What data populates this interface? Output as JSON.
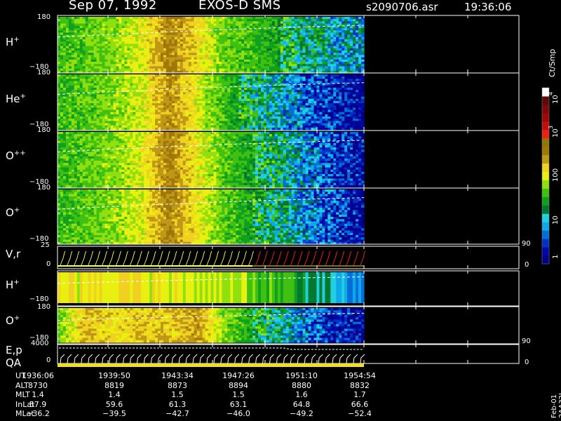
{
  "header": {
    "date": "Sep 07, 1992",
    "instrument": "EXOS-D SMS",
    "file": "s2090706.asr",
    "time": "19:36:06"
  },
  "colorbar": {
    "unit": "Ct/Smp",
    "tick_labels": [
      "1",
      "10",
      "100",
      "10",
      "10"
    ],
    "superscripts": [
      "3",
      "4"
    ],
    "colors": [
      "#000088",
      "#0008a8",
      "#0030c8",
      "#0070d8",
      "#10a8e8",
      "#20d0e0",
      "#007830",
      "#10a020",
      "#40c010",
      "#90e010",
      "#e8f010",
      "#f0d020",
      "#c09818",
      "#a07808",
      "#907808",
      "#f02010",
      "#c01008",
      "#a00808",
      "#800808",
      "#600808",
      "#ffffff"
    ]
  },
  "panels": [
    {
      "label": "H",
      "sup": "+",
      "ytop": "180",
      "ybot": "−180"
    },
    {
      "label": "He",
      "sup": "+",
      "ytop": "180",
      "ybot": "−180"
    },
    {
      "label": "O",
      "sup": "++",
      "ytop": "180",
      "ybot": "−180"
    },
    {
      "label": "O",
      "sup": "+",
      "ytop": "180",
      "ybot": "−180"
    },
    {
      "label": "V,r",
      "sup": "",
      "ytop": "25",
      "ybot": "0",
      "rtop": "90",
      "rbot": "0"
    },
    {
      "label": "H",
      "sup": "+",
      "ytop": "180",
      "ybot": "−180"
    },
    {
      "label": "O",
      "sup": "+",
      "ytop": "180",
      "ybot": "−180"
    },
    {
      "label": "E,p",
      "sup": "",
      "ytop": "4000",
      "ybot": "0",
      "rtop": "90",
      "rbot": "0"
    }
  ],
  "qa_label": "QA",
  "side_label": "Feb-01  2AA32L",
  "table": {
    "rows": [
      "UT",
      "ALT",
      "MLT",
      "InLat",
      "MLat"
    ],
    "columns": [
      [
        "1936:06",
        "8730",
        "1.4",
        "57.9",
        "−36.2"
      ],
      [
        "1939:50",
        "8819",
        "1.4",
        "59.6",
        "−39.5"
      ],
      [
        "1943:34",
        "8873",
        "1.5",
        "61.3",
        "−42.7"
      ],
      [
        "1947:26",
        "8894",
        "1.5",
        "63.1",
        "−46.0"
      ],
      [
        "1951:10",
        "8880",
        "1.6",
        "64.8",
        "−49.2"
      ],
      [
        "1954:54",
        "8832",
        "1.7",
        "66.6",
        "−52.4"
      ]
    ]
  },
  "chart_data": {
    "type": "heatmap",
    "title": "Sep 07, 1992    EXOS-D SMS",
    "x_ticks": [
      "1936:06",
      "1939:50",
      "1943:34",
      "1947:26",
      "1951:10",
      "1954:54"
    ],
    "ylim": [
      -180,
      180
    ],
    "colorbar_scale": "log",
    "colorbar_range": [
      1,
      10000
    ],
    "series": [
      {
        "name": "H+",
        "intensity_profile": [
          0.55,
          0.58,
          0.62,
          0.7,
          0.88,
          0.75,
          0.6,
          0.55,
          0.5,
          0.42,
          0.35,
          0.32
        ]
      },
      {
        "name": "He+",
        "intensity_profile": [
          0.55,
          0.58,
          0.62,
          0.68,
          0.86,
          0.7,
          0.55,
          0.45,
          0.35,
          0.22,
          0.12,
          0.05
        ]
      },
      {
        "name": "O++",
        "intensity_profile": [
          0.55,
          0.58,
          0.62,
          0.7,
          0.88,
          0.72,
          0.58,
          0.5,
          0.42,
          0.28,
          0.18,
          0.08
        ]
      },
      {
        "name": "O+",
        "intensity_profile": [
          0.55,
          0.58,
          0.62,
          0.7,
          0.88,
          0.72,
          0.58,
          0.5,
          0.42,
          0.28,
          0.18,
          0.08
        ]
      },
      {
        "name": "H+ (lower)",
        "intensity_profile": [
          0.72,
          0.7,
          0.72,
          0.74,
          0.72,
          0.7,
          0.68,
          0.6,
          0.55,
          0.45,
          0.35,
          0.25
        ]
      },
      {
        "name": "O+ (lower)",
        "intensity_profile": [
          0.6,
          0.8,
          0.74,
          0.78,
          0.76,
          0.84,
          0.62,
          0.5,
          0.42,
          0.25,
          0.15,
          0.06
        ]
      }
    ]
  }
}
